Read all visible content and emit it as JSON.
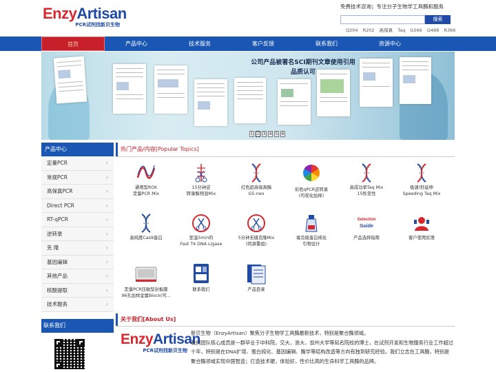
{
  "header": {
    "logo_brand_1": "Enzy",
    "logo_brand_2": "Artisan",
    "logo_tagline": "PCR试剂找新贝生物",
    "slogan": "免费技术咨询；专注分子生物学工具酶和服务",
    "search_button": "搜索",
    "search_placeholder": "",
    "hot_keywords": [
      "Q204",
      "R202",
      "高保真",
      "Taq",
      "G566",
      "Q488",
      "R366"
    ]
  },
  "nav": {
    "items": [
      "首页",
      "产品中心",
      "技术服务",
      "客户反馈",
      "联系我们",
      "资源中心"
    ],
    "active_index": 0
  },
  "banner": {
    "headline_line1": "公司产品被著名SCI期刊文章使用引用",
    "headline_line2": "品质认可",
    "pager": [
      "1",
      "2",
      "3",
      "4",
      "5",
      "6"
    ],
    "active_page": 2
  },
  "sidebar": {
    "title": "产品中心",
    "items": [
      "定量PCR",
      "常规PCR",
      "高保真PCR",
      "Direct PCR",
      "RT-qPCR",
      "逆转录",
      "克  隆",
      "基因编辑",
      "其他产品",
      "核酸提取",
      "技术服务"
    ],
    "contact_title": "联系我们"
  },
  "hot_topics": {
    "title": "热门产品/内容[Popular Topics]",
    "tiles": [
      {
        "line1": "通用型ROX",
        "line2": "定量PCR Mix",
        "icon": "wave-icon",
        "color": "#d7282f"
      },
      {
        "line1": "15分钟逆",
        "line2": "转录酶预混Mix",
        "icon": "scissors-dna-icon",
        "color": "#d7282f"
      },
      {
        "line1": "红色超高保真酶",
        "line2": "G5-neo",
        "icon": "dna-helix-icon",
        "color": "#d7282f"
      },
      {
        "line1": "彩色qPCR逆转录",
        "line2": "(可视化加样)",
        "icon": "color-wheel-icon",
        "color": "#e8a020"
      },
      {
        "line1": "高成功率Taq Mix",
        "line2": "15秒变性",
        "icon": "dna-helix-icon",
        "color": "#d7282f"
      },
      {
        "line1": "极速(秒延伸",
        "line2": "Speeding Taq Mix",
        "icon": "dna-helix-icon",
        "color": "#d7282f"
      },
      {
        "line1": "高纯度Cas9蛋白",
        "line2": "",
        "icon": "dna-helix-icon",
        "color": "#1f4aa8"
      },
      {
        "line1": "室温5min的",
        "line2": "Fast T4 DNA Ligase",
        "icon": "scissors-circle-icon",
        "color": "#d7282f"
      },
      {
        "line1": "5分钟无缝克隆Mix",
        "line2": "(同源重组)",
        "icon": "scissors-circle-icon",
        "color": "#d7282f"
      },
      {
        "line1": "毫克级蛋白纯化",
        "line2": "引物设计",
        "icon": "lab-bottle-icon",
        "color": "#1f4aa8"
      },
      {
        "line1": "产品选择指南",
        "line2": "",
        "icon": "selection-guide-icon",
        "color": "#d7282f"
      },
      {
        "line1": "客户使用反馈",
        "line2": "",
        "icon": "customer-icon",
        "color": "#d7282f"
      },
      {
        "line1": "定量PCR压敏型封板膜",
        "line2": "96孔加样金属Block(可...",
        "icon": "plate-icon",
        "color": "#d7282f"
      },
      {
        "line1": "联系我们",
        "line2": "",
        "icon": "contact-icon",
        "color": "#1f4aa8"
      },
      {
        "line1": "产品目录",
        "line2": "",
        "icon": "catalog-icon",
        "color": "#1f4aa8"
      }
    ],
    "guide_word_1": "Selection",
    "guide_word_2": "Guide"
  },
  "about": {
    "title": "关于我们[About Us]",
    "paragraph_1": "新贝生物（EnzyArtisan）聚焦分子生物学工具酶最新技术，特别是聚合酶领域。",
    "paragraph_2": "我们团队核心成员是一群毕业于中科院，交大，浙大、加州大学等知名院校的博士，在试剂开发和生物服务行业工作超过十年，特别是在DNA扩增、蛋白纯化、基因编辑、酶学等结构改造等方向有独到研究经验。我们立志在工具酶，特别是聚合酶领域实现中国智造；打造技术硬，体验好，性价比高的生命科学工具酶的品牌。"
  }
}
